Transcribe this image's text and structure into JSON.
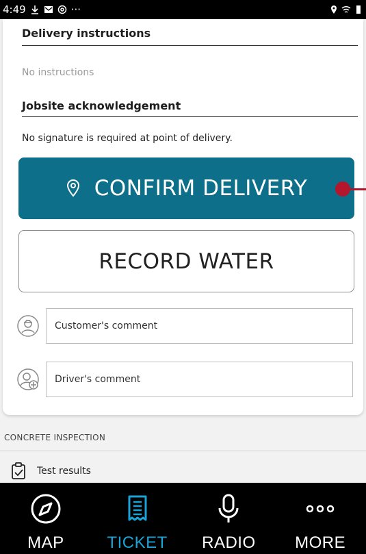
{
  "status_bar": {
    "time": "4:49",
    "more": "···"
  },
  "delivery": {
    "instructions_title": "Delivery instructions",
    "instructions_value": "No instructions",
    "ack_title": "Jobsite acknowledgement",
    "ack_text": "No signature is required at point of delivery."
  },
  "actions": {
    "confirm_label": "CONFIRM DELIVERY",
    "record_label": "RECORD WATER"
  },
  "comments": {
    "customer_placeholder": "Customer's comment",
    "driver_placeholder": "Driver's comment"
  },
  "inspection": {
    "header": "CONCRETE INSPECTION",
    "test_results": "Test results"
  },
  "nav": {
    "items": [
      {
        "label": "MAP",
        "icon": "compass-icon"
      },
      {
        "label": "TICKET",
        "icon": "receipt-icon"
      },
      {
        "label": "RADIO",
        "icon": "microphone-icon"
      },
      {
        "label": "MORE",
        "icon": "more-dots-icon"
      }
    ],
    "active": "TICKET"
  },
  "colors": {
    "primary": "#0e6f8a",
    "active_nav": "#1aa3d6",
    "marker": "#b3162d"
  }
}
